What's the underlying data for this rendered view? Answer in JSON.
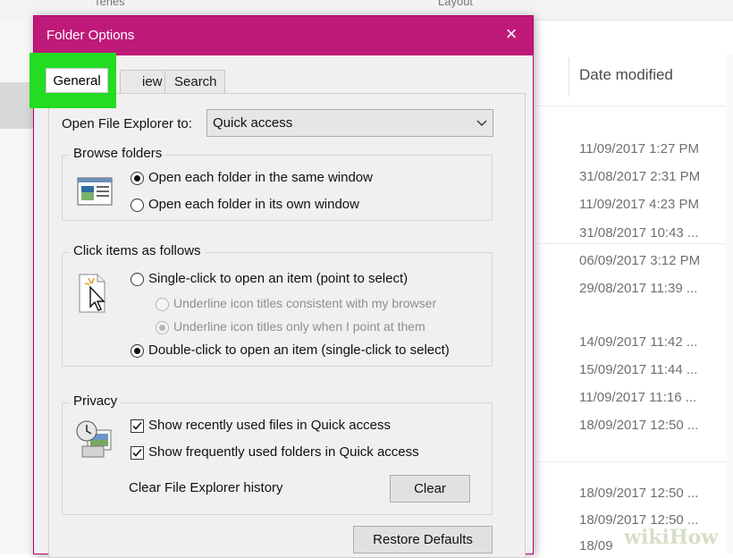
{
  "explorer": {
    "ghost_left": "Tenes",
    "ghost_right": "Layout",
    "column_header": "Date modified",
    "dates": [
      "11/09/2017 1:27 PM",
      "31/08/2017 2:31 PM",
      "11/09/2017 4:23 PM",
      "31/08/2017 10:43 ...",
      "06/09/2017 3:12 PM",
      "29/08/2017 11:39 ...",
      "14/09/2017 11:42 ...",
      "15/09/2017 11:44 ...",
      "11/09/2017 11:16 ...",
      "18/09/2017 12:50 ...",
      "18/09/2017 12:50 ...",
      "18/09/2017 12:50 ...",
      "18/09"
    ]
  },
  "dialog": {
    "title": "Folder Options",
    "close_glyph": "×",
    "tabs": {
      "general": "General",
      "view": "iew",
      "search": "Search"
    },
    "open_to_label": "Open File Explorer to:",
    "open_to_value": "Quick access",
    "browse": {
      "title": "Browse folders",
      "same_window": "Open each folder in the same window",
      "own_window": "Open each folder in its own window",
      "selected": "same"
    },
    "click": {
      "title": "Click items as follows",
      "single": "Single-click to open an item (point to select)",
      "underline_browser": "Underline icon titles consistent with my browser",
      "underline_point": "Underline icon titles only when I point at them",
      "double": "Double-click to open an item (single-click to select)",
      "selected": "double"
    },
    "privacy": {
      "title": "Privacy",
      "recent_files": "Show recently used files in Quick access",
      "frequent_folders": "Show frequently used folders in Quick access",
      "recent_checked": true,
      "frequent_checked": true,
      "clear_history_label": "Clear File Explorer history",
      "clear_button": "Clear"
    },
    "restore_defaults": "Restore Defaults"
  },
  "watermark": "wikiHow",
  "colors": {
    "titlebar": "#bf1a79",
    "highlight": "#22dd22"
  }
}
